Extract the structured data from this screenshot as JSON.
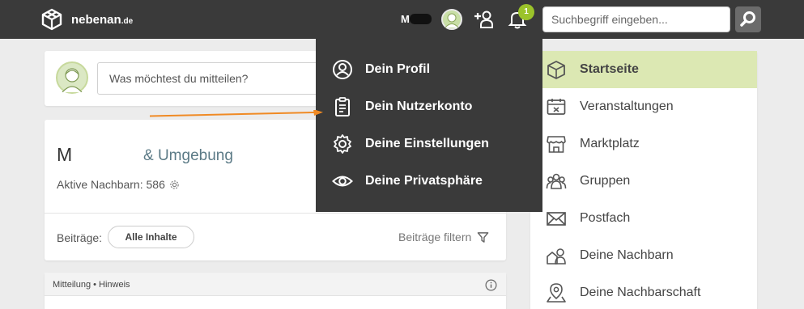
{
  "brand": {
    "name": "nebenan",
    "tld": ".de"
  },
  "topbar": {
    "user_initial": "M",
    "notification_count": "1",
    "search_placeholder": "Suchbegriff eingeben..."
  },
  "composer": {
    "placeholder": "Was möchtest du mitteilen?"
  },
  "neighborhood": {
    "name_initial": "M",
    "name_suffix": "& Umgebung",
    "active_label": "Aktive Nachbarn: 586",
    "posts_label": "Beiträge:",
    "filter_chip": "Alle Inhalte",
    "filter_link": "Beiträge filtern"
  },
  "notice": {
    "label": "Mitteilung • Hinweis"
  },
  "user_menu": {
    "items": [
      {
        "label": "Dein Profil",
        "icon": "profile-icon"
      },
      {
        "label": "Dein Nutzerkonto",
        "icon": "clipboard-icon"
      },
      {
        "label": "Deine Einstellungen",
        "icon": "gear-icon"
      },
      {
        "label": "Deine Privatsphäre",
        "icon": "eye-icon"
      }
    ]
  },
  "sidebar": {
    "items": [
      {
        "label": "Startseite",
        "icon": "house-icon",
        "active": true
      },
      {
        "label": "Veranstaltungen",
        "icon": "calendar-icon"
      },
      {
        "label": "Marktplatz",
        "icon": "store-icon"
      },
      {
        "label": "Gruppen",
        "icon": "group-icon"
      },
      {
        "label": "Postfach",
        "icon": "mail-icon"
      },
      {
        "label": "Deine Nachbarn",
        "icon": "neighbors-icon"
      },
      {
        "label": "Deine Nachbarschaft",
        "icon": "map-pin-icon"
      }
    ]
  },
  "colors": {
    "topbar": "#3a3a3a",
    "accent_green": "#9bc32a",
    "active_bg": "#dce8b3",
    "arrow": "#f08a24"
  }
}
